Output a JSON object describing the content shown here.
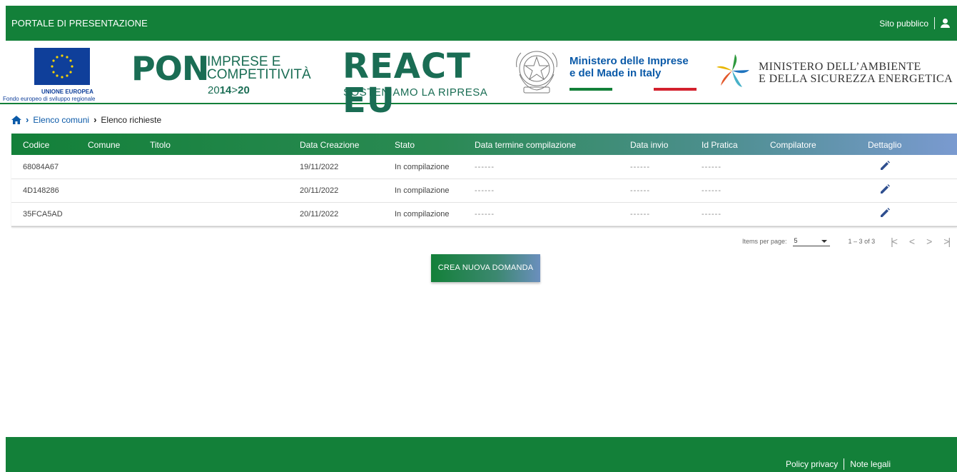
{
  "header": {
    "title": "PORTALE DI PRESENTAZIONE",
    "public_site_link": "Sito pubblico",
    "user_icon": "user-icon"
  },
  "logos": {
    "eu_title": "UNIONE EUROPEA",
    "eu_subtitle": "Fondo europeo di sviluppo regionale",
    "pon_mark": "PON",
    "pon_line1": "IMPRESE E",
    "pon_line2": "COMPETITIVITÀ",
    "pon_years_a": "20",
    "pon_years_b": "14",
    "pon_years_c": ">",
    "pon_years_d": "20",
    "react_mark": "REACT EU",
    "react_sub": "SOSTENIAMO LA RIPRESA",
    "mimit_line1": "Ministero delle Imprese",
    "mimit_line2": "e del Made in Italy",
    "mase_line1": "MINISTERO DELL’AMBIENTE",
    "mase_line2": "E DELLA SICUREZZA ENERGETICA"
  },
  "breadcrumb": {
    "home_icon": "home-icon",
    "link": "Elenco comuni",
    "current": "Elenco richieste"
  },
  "table": {
    "columns": [
      "Codice",
      "Comune",
      "Titolo",
      "Data Creazione",
      "Stato",
      "Data termine compilazione",
      "Data invio",
      "Id Pratica",
      "Compilatore",
      "Dettaglio"
    ],
    "rows": [
      {
        "codice": "68084A67",
        "comune": "",
        "titolo": "",
        "data_creazione": "19/11/2022",
        "stato": "In compilazione",
        "data_termine": "------",
        "data_invio": "------",
        "id_pratica": "------",
        "compilatore": ""
      },
      {
        "codice": "4D148286",
        "comune": "",
        "titolo": "",
        "data_creazione": "20/11/2022",
        "stato": "In compilazione",
        "data_termine": "------",
        "data_invio": "------",
        "id_pratica": "------",
        "compilatore": ""
      },
      {
        "codice": "35FCA5AD",
        "comune": "",
        "titolo": "",
        "data_creazione": "20/11/2022",
        "stato": "In compilazione",
        "data_termine": "------",
        "data_invio": "------",
        "id_pratica": "------",
        "compilatore": ""
      }
    ]
  },
  "paginator": {
    "items_per_page_label": "Items per page:",
    "items_per_page_value": "5",
    "range": "1 – 3 of 3",
    "first": "|<",
    "prev": "<",
    "next": ">",
    "last": ">|"
  },
  "actions": {
    "create_label": "CREA NUOVA DOMANDA"
  },
  "footer": {
    "privacy": "Policy privacy",
    "legal": "Note legali"
  },
  "colors": {
    "primary_green": "#138039",
    "link_blue": "#0b5aa8",
    "header_gradient_end": "#7a9ad0"
  }
}
